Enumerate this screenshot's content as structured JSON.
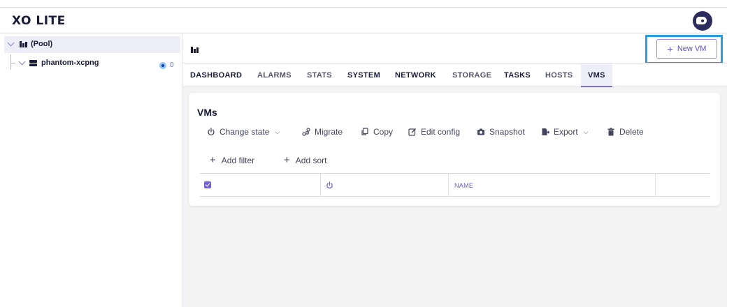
{
  "app": {
    "title": "XO LITE"
  },
  "icons": [
    "user-avatar-icon",
    "chevron-down-icon",
    "pool-icon",
    "host-icon",
    "power-icon",
    "migrate-icon",
    "copy-icon",
    "edit-icon",
    "camera-icon",
    "export-icon",
    "trash-icon",
    "plus-icon"
  ],
  "colors": {
    "accent": "#7c6fd8",
    "highlight_box": "#28a0e0",
    "status_running": "#1a3e9e"
  },
  "sidebar": {
    "pool_label": "(Pool)",
    "host_label": "phantom-xcpng",
    "host_running_count": "0"
  },
  "header": {
    "new_vm_label": "New VM"
  },
  "tabs": [
    {
      "label": "DASHBOARD"
    },
    {
      "label": "ALARMS"
    },
    {
      "label": "STATS"
    },
    {
      "label": "SYSTEM"
    },
    {
      "label": "NETWORK"
    },
    {
      "label": "STORAGE"
    },
    {
      "label": "TASKS"
    },
    {
      "label": "HOSTS"
    },
    {
      "label": "VMS"
    }
  ],
  "active_tab": "VMS",
  "vms_panel": {
    "title": "VMs",
    "actions": [
      {
        "label": "Change state"
      },
      {
        "label": "Migrate"
      },
      {
        "label": "Copy"
      },
      {
        "label": "Edit config"
      },
      {
        "label": "Snapshot"
      },
      {
        "label": "Export"
      },
      {
        "label": "Delete"
      }
    ],
    "add_filter_label": "Add filter",
    "add_sort_label": "Add sort",
    "columns": {
      "name": "NAME"
    }
  }
}
